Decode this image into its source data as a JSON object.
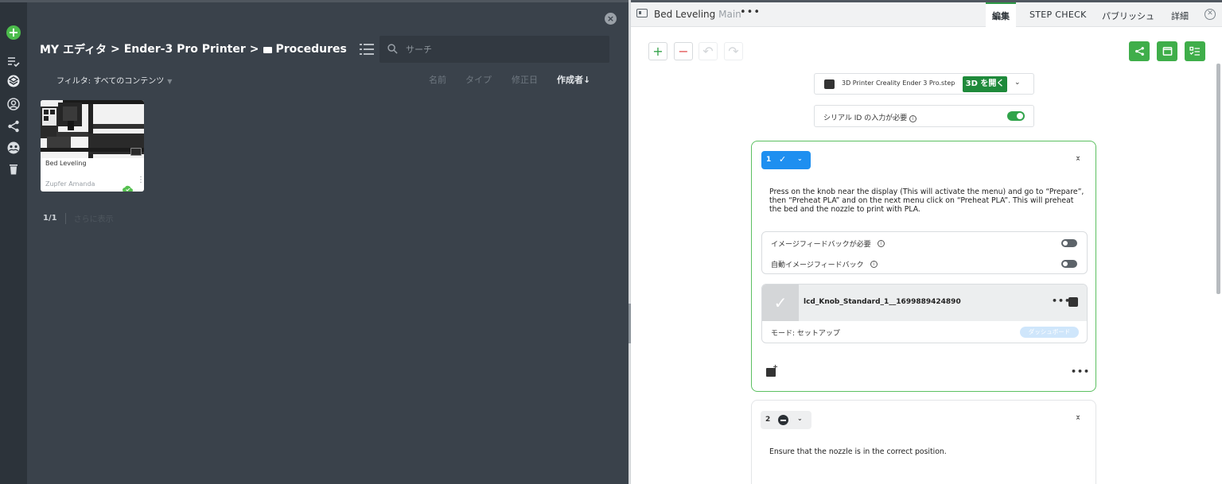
{
  "library": {
    "breadcrumb": {
      "root": "MY エディタ",
      "sep": ">",
      "folder1": "Ender-3 Pro Printer",
      "folder2": "Procedures"
    },
    "search_placeholder": "サーチ",
    "filter_label": "フィルタ: すべてのコンテンツ",
    "sort_columns": {
      "name": "名前",
      "type": "タイプ",
      "modified": "修正日",
      "author": "作成者↓"
    },
    "cards": [
      {
        "title": "Bed Leveling",
        "author": "Zupfer Amanda",
        "synced": true
      }
    ],
    "pagination": {
      "count": "1/1",
      "more": "さらに表示"
    }
  },
  "editor": {
    "title": "Bed Leveling",
    "version": "Main",
    "title_more": "•••",
    "tabs": {
      "edit": "編集",
      "step_check": "STEP CHECK",
      "publish": "パブリッシュ",
      "details": "詳細"
    },
    "active_tab": "edit",
    "model": {
      "file": "3D Printer Creality Ender 3 Pro.step",
      "open_label": "3D を開く"
    },
    "serial": {
      "label": "シリアル ID の入力が必要",
      "enabled": true
    },
    "steps": [
      {
        "number": "1",
        "text": "Press on the knob near the display (This will activate the menu) and go to “Prepare”, then “Preheat PLA” and on the next menu click on “Preheat PLA”. This will preheat the bed and the nozzle to print with PLA.",
        "feedback": {
          "image_required_label": "イメージフィードバックが必要",
          "image_required": false,
          "auto_image_label": "自動イメージフィードバック",
          "auto_image": false
        },
        "media": {
          "name": "lcd_Knob_Standard_1__1699889424890",
          "mode": "モード: セットアップ",
          "tag": "ダッシュボード"
        },
        "more": "•••"
      },
      {
        "number": "2",
        "text": "Ensure that the nozzle is in the correct position."
      }
    ]
  },
  "colors": {
    "accent_green": "#3fae4a",
    "step_active_border": "#5cc061",
    "step_badge_blue": "#1e8ff0",
    "open_3d_green": "#1f8a3b",
    "sidebar_bg": "#2c333a",
    "library_bg": "#3a424b"
  }
}
